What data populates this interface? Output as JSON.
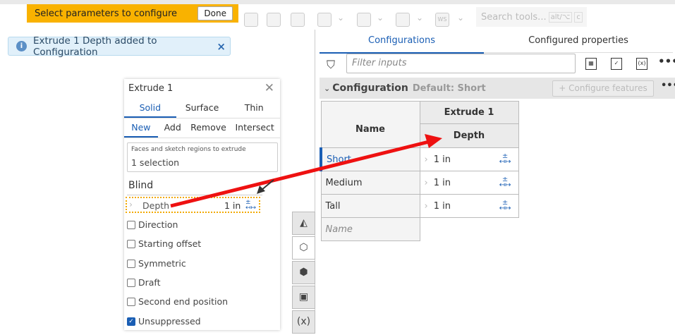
{
  "banner": {
    "text": "Select parameters to configure",
    "done_label": "Done"
  },
  "toolbar": {
    "search_placeholder": "Search tools...",
    "shortcut_1": "alt/⌥",
    "shortcut_2": "c",
    "ws_label": "WS"
  },
  "notice": {
    "text": "Extrude 1 Depth added to Configuration",
    "close": "×"
  },
  "panel": {
    "tabs": [
      {
        "label": "Configurations",
        "active": true
      },
      {
        "label": "Configured properties",
        "active": false
      }
    ],
    "filter_placeholder": "Filter inputs",
    "config_title": "Configuration",
    "config_default": "Default: Short",
    "configure_features": "Configure features",
    "more": "•••",
    "table": {
      "feature_header": "Extrude 1",
      "name_header": "Name",
      "param_header": "Depth",
      "rows": [
        {
          "name": "Short",
          "value": "1 in",
          "active": true
        },
        {
          "name": "Medium",
          "value": "1 in"
        },
        {
          "name": "Tall",
          "value": "1 in"
        }
      ],
      "name_placeholder": "Name"
    }
  },
  "dialog": {
    "title": "Extrude 1",
    "types": [
      "Solid",
      "Surface",
      "Thin"
    ],
    "ops": [
      "New",
      "Add",
      "Remove",
      "Intersect"
    ],
    "selection_label": "Faces and sketch regions to extrude",
    "selection_value": "1 selection",
    "end_type": "Blind",
    "depth_label": "Depth",
    "depth_value": "1 in",
    "options": [
      {
        "label": "Direction",
        "checked": false
      },
      {
        "label": "Starting offset",
        "checked": false
      },
      {
        "label": "Symmetric",
        "checked": false
      },
      {
        "label": "Draft",
        "checked": false
      },
      {
        "label": "Second end position",
        "checked": false
      },
      {
        "label": "Unsuppressed",
        "checked": true
      }
    ]
  },
  "colors": {
    "accent": "#1a5eb4",
    "banner": "#f9b200",
    "arrow": "#ee1111"
  }
}
